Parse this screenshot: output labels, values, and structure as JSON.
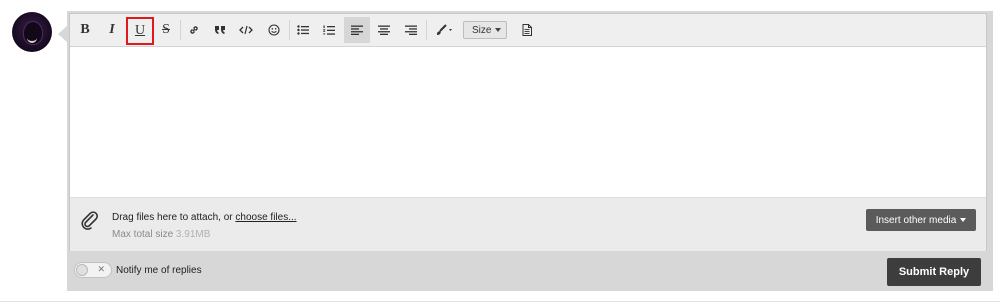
{
  "toolbar": {
    "bold": "B",
    "italic": "I",
    "underline": "U",
    "strike": "S",
    "size_label": "Size"
  },
  "attachments": {
    "prompt": "Drag files here to attach, or",
    "choose_link": "choose files...",
    "max_label": "Max total size",
    "max_value": "3.91MB",
    "insert_media": "Insert other media"
  },
  "footer": {
    "notify_label": "Notify me of replies",
    "submit_label": "Submit Reply"
  }
}
